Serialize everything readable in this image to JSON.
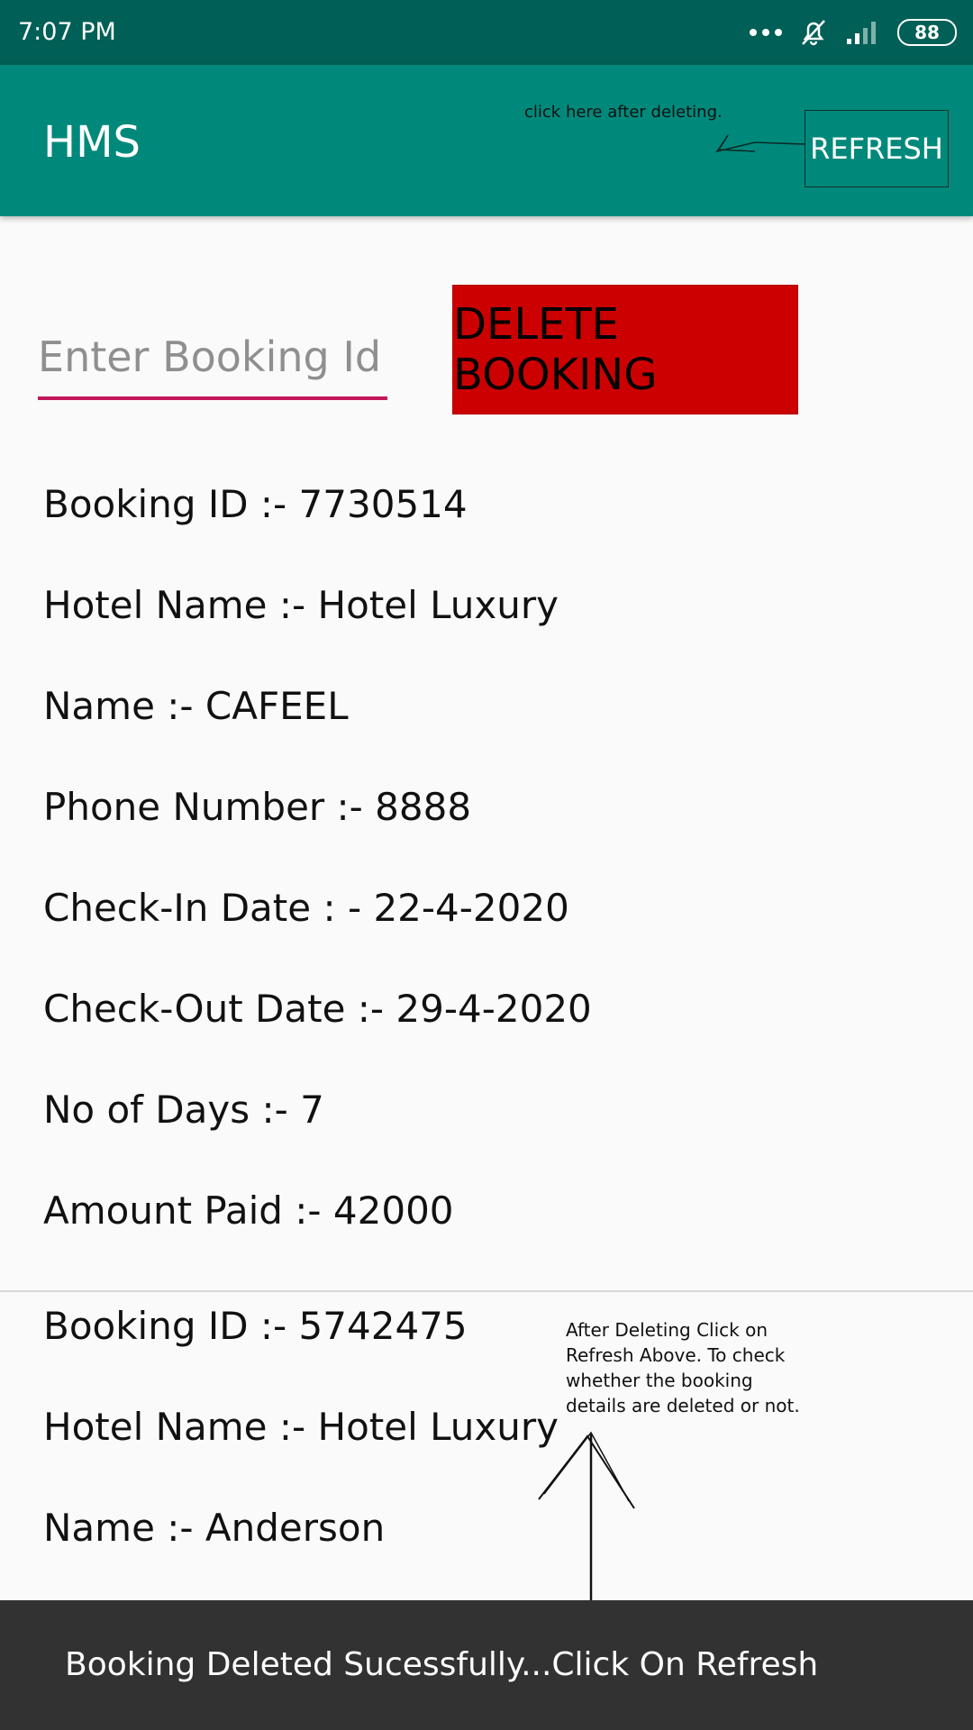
{
  "status_bar": {
    "time": "7:07 PM",
    "battery": "88",
    "icons": [
      "more-dots-icon",
      "bell-off-icon",
      "signal-icon",
      "battery-icon"
    ]
  },
  "app_bar": {
    "title": "HMS",
    "hint": "click here after deleting.",
    "refresh_label": "REFRESH"
  },
  "form": {
    "booking_id_placeholder": "Enter Booking Id",
    "booking_id_value": "",
    "delete_label": "DELETE BOOKING"
  },
  "bookings": [
    {
      "booking_id": "Booking ID :- 7730514",
      "hotel_name": "Hotel Name :- Hotel Luxury",
      "name": "Name :- CAFEEL",
      "phone": "Phone Number :- 8888",
      "check_in": "Check-In Date : - 22-4-2020",
      "check_out": "Check-Out Date :- 29-4-2020",
      "days": "No of Days :- 7",
      "amount": "Amount Paid :- 42000"
    },
    {
      "booking_id": "Booking ID :- 5742475",
      "hotel_name": "Hotel Name :- Hotel Luxury",
      "name": "Name :- Anderson"
    }
  ],
  "annotation": {
    "note": "After Deleting Click on Refresh Above. To check whether the booking details are deleted or not."
  },
  "snackbar": {
    "message": "Booking Deleted Sucessfully...Click On Refresh"
  },
  "colors": {
    "status_bar": "#005f56",
    "app_bar": "#00897b",
    "delete_button": "#cc0000",
    "input_underline": "#c2185b",
    "snackbar": "#323232"
  }
}
